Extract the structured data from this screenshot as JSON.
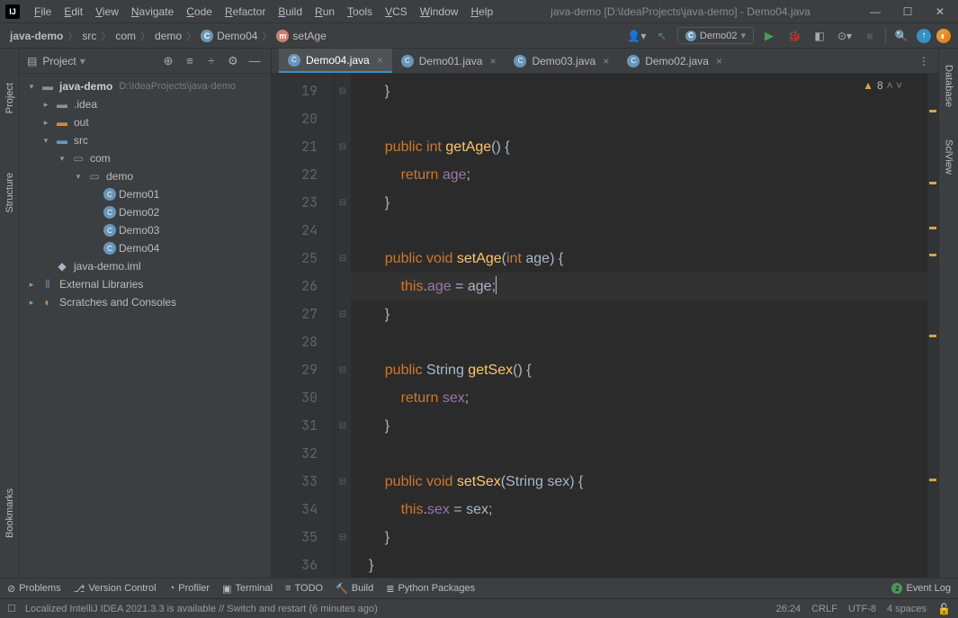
{
  "title": "java-demo [D:\\IdeaProjects\\java-demo] - Demo04.java",
  "menu": [
    "File",
    "Edit",
    "View",
    "Navigate",
    "Code",
    "Refactor",
    "Build",
    "Run",
    "Tools",
    "VCS",
    "Window",
    "Help"
  ],
  "breadcrumb": {
    "root": "java-demo",
    "src": "src",
    "pkg1": "com",
    "pkg2": "demo",
    "cls": "Demo04",
    "meth": "setAge"
  },
  "runConfig": "Demo02",
  "panel": {
    "title": "Project",
    "root": "java-demo",
    "rootPath": "D:\\IdeaProjects\\java-demo",
    "idea": ".idea",
    "out": "out",
    "src": "src",
    "com": "com",
    "demo": "demo",
    "files": [
      "Demo01",
      "Demo02",
      "Demo03",
      "Demo04"
    ],
    "iml": "java-demo.iml",
    "ext": "External Libraries",
    "scratch": "Scratches and Consoles"
  },
  "tabs": [
    {
      "label": "Demo04.java",
      "active": true
    },
    {
      "label": "Demo01.java",
      "active": false
    },
    {
      "label": "Demo03.java",
      "active": false
    },
    {
      "label": "Demo02.java",
      "active": false
    }
  ],
  "inspections": {
    "warn": "8"
  },
  "code": {
    "startLine": 19,
    "lines": [
      {
        "n": 19,
        "html": "    <span class='br'>}</span>"
      },
      {
        "n": 20,
        "html": ""
      },
      {
        "n": 21,
        "html": "    <span class='kw'>public</span> <span class='kw'>int</span> <span class='id'>getAge</span><span class='br'>() {</span>"
      },
      {
        "n": 22,
        "html": "        <span class='kw'>return</span> <span class='field'>age</span><span class='op'>;</span>"
      },
      {
        "n": 23,
        "html": "    <span class='br'>}</span>"
      },
      {
        "n": 24,
        "html": ""
      },
      {
        "n": 25,
        "html": "    <span class='kw'>public</span> <span class='kw'>void</span> <span class='id'>setAge</span><span class='br'>(</span><span class='kw'>int</span> <span class='typ'>age</span><span class='br'>) {</span>"
      },
      {
        "n": 26,
        "html": "        <span class='kw'>this</span><span class='op'>.</span><span class='field'>age</span> <span class='op'>=</span> <span class='typ'>age</span><span class='op'>;</span>",
        "hl": true,
        "caret": true
      },
      {
        "n": 27,
        "html": "    <span class='br'>}</span>"
      },
      {
        "n": 28,
        "html": ""
      },
      {
        "n": 29,
        "html": "    <span class='kw'>public</span> <span class='typ'>String</span> <span class='id'>getSex</span><span class='br'>() {</span>"
      },
      {
        "n": 30,
        "html": "        <span class='kw'>return</span> <span class='field'>sex</span><span class='op'>;</span>"
      },
      {
        "n": 31,
        "html": "    <span class='br'>}</span>"
      },
      {
        "n": 32,
        "html": ""
      },
      {
        "n": 33,
        "html": "    <span class='kw'>public</span> <span class='kw'>void</span> <span class='id'>setSex</span><span class='br'>(</span><span class='typ'>String sex</span><span class='br'>) {</span>"
      },
      {
        "n": 34,
        "html": "        <span class='kw'>this</span><span class='op'>.</span><span class='field'>sex</span> <span class='op'>=</span> <span class='typ'>sex</span><span class='op'>;</span>"
      },
      {
        "n": 35,
        "html": "    <span class='br'>}</span>"
      },
      {
        "n": 36,
        "html": "<span class='br'>}</span>"
      }
    ]
  },
  "bottomTools": [
    "Problems",
    "Version Control",
    "Profiler",
    "Terminal",
    "TODO",
    "Build",
    "Python Packages"
  ],
  "eventLog": "Event Log",
  "notif": "Localized IntelliJ IDEA 2021.3.3 is available // Switch and restart (6 minutes ago)",
  "status": {
    "pos": "26:24",
    "sep": "CRLF",
    "enc": "UTF-8",
    "indent": "4 spaces"
  },
  "sideTabs": {
    "project": "Project",
    "structure": "Structure",
    "bookmarks": "Bookmarks",
    "database": "Database",
    "sciview": "SciView"
  }
}
